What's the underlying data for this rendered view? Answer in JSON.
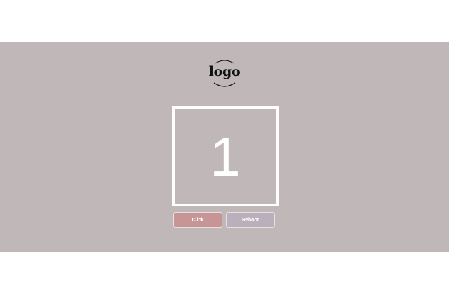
{
  "logo": {
    "text": "logo"
  },
  "counter": {
    "value": "1"
  },
  "buttons": {
    "click_label": "Click",
    "reboot_label": "Reboot"
  },
  "colors": {
    "background": "#c0b8b8",
    "click_button": "#c89596",
    "reboot_button": "#b9b0bb",
    "counter_border": "#ffffff"
  }
}
